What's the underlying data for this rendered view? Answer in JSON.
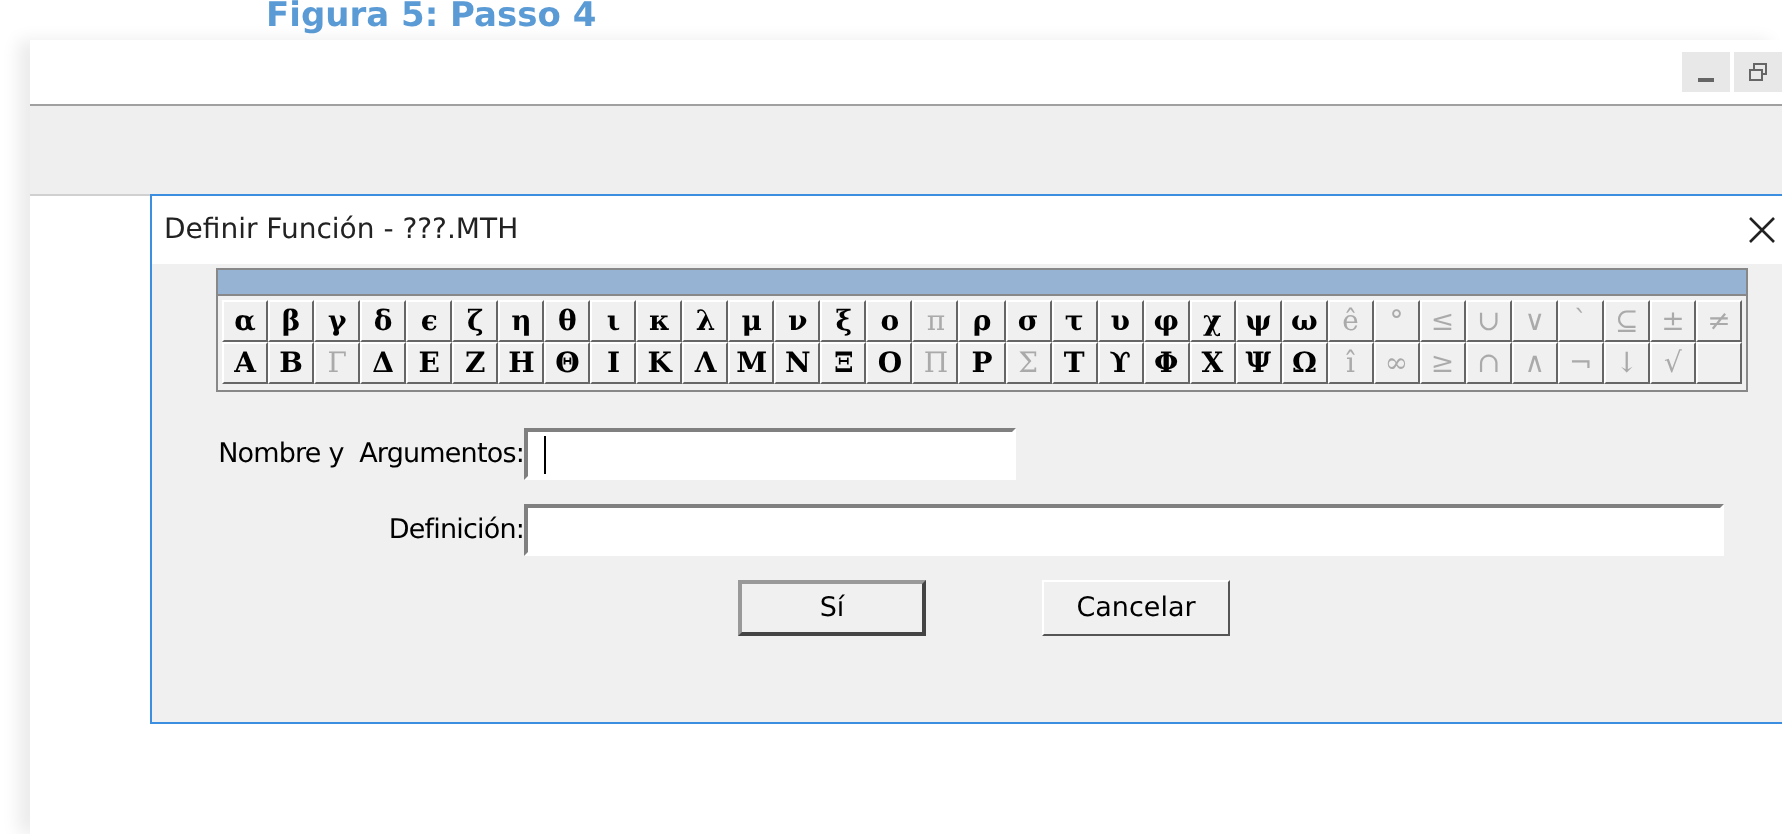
{
  "caption": "Figura 5: Passo 4",
  "dialog": {
    "title": "Definir Función - ???.MTH",
    "symbol_rows": [
      [
        {
          "symbol": "α",
          "disabled": false
        },
        {
          "symbol": "β",
          "disabled": false
        },
        {
          "symbol": "γ",
          "disabled": false
        },
        {
          "symbol": "δ",
          "disabled": false
        },
        {
          "symbol": "ϵ",
          "disabled": false
        },
        {
          "symbol": "ζ",
          "disabled": false
        },
        {
          "symbol": "η",
          "disabled": false
        },
        {
          "symbol": "θ",
          "disabled": false
        },
        {
          "symbol": "ι",
          "disabled": false
        },
        {
          "symbol": "κ",
          "disabled": false
        },
        {
          "symbol": "λ",
          "disabled": false
        },
        {
          "symbol": "μ",
          "disabled": false
        },
        {
          "symbol": "ν",
          "disabled": false
        },
        {
          "symbol": "ξ",
          "disabled": false
        },
        {
          "symbol": "ο",
          "disabled": false
        },
        {
          "symbol": "π",
          "disabled": true
        },
        {
          "symbol": "ρ",
          "disabled": false
        },
        {
          "symbol": "σ",
          "disabled": false
        },
        {
          "symbol": "τ",
          "disabled": false
        },
        {
          "symbol": "υ",
          "disabled": false
        },
        {
          "symbol": "φ",
          "disabled": false
        },
        {
          "symbol": "χ",
          "disabled": false
        },
        {
          "symbol": "ψ",
          "disabled": false
        },
        {
          "symbol": "ω",
          "disabled": false
        },
        {
          "symbol": "ê",
          "disabled": true
        },
        {
          "symbol": "°",
          "disabled": true
        },
        {
          "symbol": "≤",
          "disabled": true
        },
        {
          "symbol": "∪",
          "disabled": true
        },
        {
          "symbol": "∨",
          "disabled": true
        },
        {
          "symbol": "`",
          "disabled": true
        },
        {
          "symbol": "⊆",
          "disabled": true
        },
        {
          "symbol": "±",
          "disabled": true
        },
        {
          "symbol": "≠",
          "disabled": true
        }
      ],
      [
        {
          "symbol": "Α",
          "disabled": false
        },
        {
          "symbol": "Β",
          "disabled": false
        },
        {
          "symbol": "Γ",
          "disabled": true
        },
        {
          "symbol": "Δ",
          "disabled": false
        },
        {
          "symbol": "Ε",
          "disabled": false
        },
        {
          "symbol": "Ζ",
          "disabled": false
        },
        {
          "symbol": "Η",
          "disabled": false
        },
        {
          "symbol": "Θ",
          "disabled": false
        },
        {
          "symbol": "Ι",
          "disabled": false
        },
        {
          "symbol": "Κ",
          "disabled": false
        },
        {
          "symbol": "Λ",
          "disabled": false
        },
        {
          "symbol": "Μ",
          "disabled": false
        },
        {
          "symbol": "Ν",
          "disabled": false
        },
        {
          "symbol": "Ξ",
          "disabled": false
        },
        {
          "symbol": "Ο",
          "disabled": false
        },
        {
          "symbol": "Π",
          "disabled": true
        },
        {
          "symbol": "Ρ",
          "disabled": false
        },
        {
          "symbol": "Σ",
          "disabled": true
        },
        {
          "symbol": "Τ",
          "disabled": false
        },
        {
          "symbol": "ϒ",
          "disabled": false
        },
        {
          "symbol": "Φ",
          "disabled": false
        },
        {
          "symbol": "Χ",
          "disabled": false
        },
        {
          "symbol": "Ψ",
          "disabled": false
        },
        {
          "symbol": "Ω",
          "disabled": false
        },
        {
          "symbol": "î",
          "disabled": true
        },
        {
          "symbol": "∞",
          "disabled": true
        },
        {
          "symbol": "≥",
          "disabled": true
        },
        {
          "symbol": "∩",
          "disabled": true
        },
        {
          "symbol": "∧",
          "disabled": true
        },
        {
          "symbol": "¬",
          "disabled": true
        },
        {
          "symbol": "↓",
          "disabled": true
        },
        {
          "symbol": "√",
          "disabled": true
        }
      ]
    ],
    "fields": [
      {
        "label": "Nombre y  Argumentos:",
        "focused": true,
        "wide": false
      },
      {
        "label": "Definición:",
        "focused": false,
        "wide": true
      }
    ],
    "buttons": [
      {
        "label": "Sí",
        "default": true
      },
      {
        "label": "Cancelar",
        "default": false
      }
    ]
  }
}
